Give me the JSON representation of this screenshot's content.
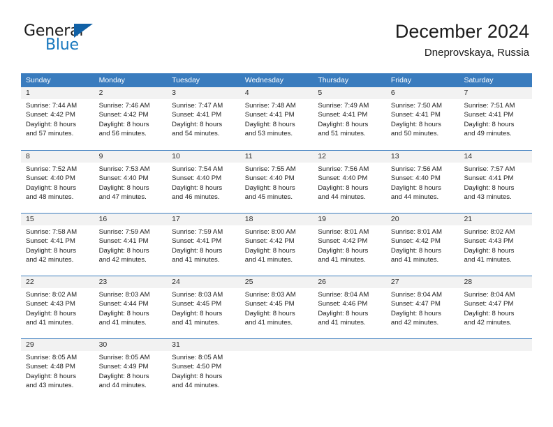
{
  "brand": {
    "name_part1": "General",
    "name_part2": "Blue",
    "colors": {
      "blue": "#1878be",
      "flag": "#1161a6",
      "dark": "#1b1b1b"
    }
  },
  "header": {
    "title": "December 2024",
    "subtitle": "Dneprovskaya, Russia"
  },
  "theme": {
    "header_bar": "#3a7cbe",
    "day_band": "#f2f2f2",
    "row_divider": "#3a7cbe",
    "text": "#202020"
  },
  "weekdays": [
    "Sunday",
    "Monday",
    "Tuesday",
    "Wednesday",
    "Thursday",
    "Friday",
    "Saturday"
  ],
  "weeks": [
    [
      {
        "day": "1",
        "sunrise": "Sunrise: 7:44 AM",
        "sunset": "Sunset: 4:42 PM",
        "daylight1": "Daylight: 8 hours",
        "daylight2": "and 57 minutes."
      },
      {
        "day": "2",
        "sunrise": "Sunrise: 7:46 AM",
        "sunset": "Sunset: 4:42 PM",
        "daylight1": "Daylight: 8 hours",
        "daylight2": "and 56 minutes."
      },
      {
        "day": "3",
        "sunrise": "Sunrise: 7:47 AM",
        "sunset": "Sunset: 4:41 PM",
        "daylight1": "Daylight: 8 hours",
        "daylight2": "and 54 minutes."
      },
      {
        "day": "4",
        "sunrise": "Sunrise: 7:48 AM",
        "sunset": "Sunset: 4:41 PM",
        "daylight1": "Daylight: 8 hours",
        "daylight2": "and 53 minutes."
      },
      {
        "day": "5",
        "sunrise": "Sunrise: 7:49 AM",
        "sunset": "Sunset: 4:41 PM",
        "daylight1": "Daylight: 8 hours",
        "daylight2": "and 51 minutes."
      },
      {
        "day": "6",
        "sunrise": "Sunrise: 7:50 AM",
        "sunset": "Sunset: 4:41 PM",
        "daylight1": "Daylight: 8 hours",
        "daylight2": "and 50 minutes."
      },
      {
        "day": "7",
        "sunrise": "Sunrise: 7:51 AM",
        "sunset": "Sunset: 4:41 PM",
        "daylight1": "Daylight: 8 hours",
        "daylight2": "and 49 minutes."
      }
    ],
    [
      {
        "day": "8",
        "sunrise": "Sunrise: 7:52 AM",
        "sunset": "Sunset: 4:40 PM",
        "daylight1": "Daylight: 8 hours",
        "daylight2": "and 48 minutes."
      },
      {
        "day": "9",
        "sunrise": "Sunrise: 7:53 AM",
        "sunset": "Sunset: 4:40 PM",
        "daylight1": "Daylight: 8 hours",
        "daylight2": "and 47 minutes."
      },
      {
        "day": "10",
        "sunrise": "Sunrise: 7:54 AM",
        "sunset": "Sunset: 4:40 PM",
        "daylight1": "Daylight: 8 hours",
        "daylight2": "and 46 minutes."
      },
      {
        "day": "11",
        "sunrise": "Sunrise: 7:55 AM",
        "sunset": "Sunset: 4:40 PM",
        "daylight1": "Daylight: 8 hours",
        "daylight2": "and 45 minutes."
      },
      {
        "day": "12",
        "sunrise": "Sunrise: 7:56 AM",
        "sunset": "Sunset: 4:40 PM",
        "daylight1": "Daylight: 8 hours",
        "daylight2": "and 44 minutes."
      },
      {
        "day": "13",
        "sunrise": "Sunrise: 7:56 AM",
        "sunset": "Sunset: 4:40 PM",
        "daylight1": "Daylight: 8 hours",
        "daylight2": "and 44 minutes."
      },
      {
        "day": "14",
        "sunrise": "Sunrise: 7:57 AM",
        "sunset": "Sunset: 4:41 PM",
        "daylight1": "Daylight: 8 hours",
        "daylight2": "and 43 minutes."
      }
    ],
    [
      {
        "day": "15",
        "sunrise": "Sunrise: 7:58 AM",
        "sunset": "Sunset: 4:41 PM",
        "daylight1": "Daylight: 8 hours",
        "daylight2": "and 42 minutes."
      },
      {
        "day": "16",
        "sunrise": "Sunrise: 7:59 AM",
        "sunset": "Sunset: 4:41 PM",
        "daylight1": "Daylight: 8 hours",
        "daylight2": "and 42 minutes."
      },
      {
        "day": "17",
        "sunrise": "Sunrise: 7:59 AM",
        "sunset": "Sunset: 4:41 PM",
        "daylight1": "Daylight: 8 hours",
        "daylight2": "and 41 minutes."
      },
      {
        "day": "18",
        "sunrise": "Sunrise: 8:00 AM",
        "sunset": "Sunset: 4:42 PM",
        "daylight1": "Daylight: 8 hours",
        "daylight2": "and 41 minutes."
      },
      {
        "day": "19",
        "sunrise": "Sunrise: 8:01 AM",
        "sunset": "Sunset: 4:42 PM",
        "daylight1": "Daylight: 8 hours",
        "daylight2": "and 41 minutes."
      },
      {
        "day": "20",
        "sunrise": "Sunrise: 8:01 AM",
        "sunset": "Sunset: 4:42 PM",
        "daylight1": "Daylight: 8 hours",
        "daylight2": "and 41 minutes."
      },
      {
        "day": "21",
        "sunrise": "Sunrise: 8:02 AM",
        "sunset": "Sunset: 4:43 PM",
        "daylight1": "Daylight: 8 hours",
        "daylight2": "and 41 minutes."
      }
    ],
    [
      {
        "day": "22",
        "sunrise": "Sunrise: 8:02 AM",
        "sunset": "Sunset: 4:43 PM",
        "daylight1": "Daylight: 8 hours",
        "daylight2": "and 41 minutes."
      },
      {
        "day": "23",
        "sunrise": "Sunrise: 8:03 AM",
        "sunset": "Sunset: 4:44 PM",
        "daylight1": "Daylight: 8 hours",
        "daylight2": "and 41 minutes."
      },
      {
        "day": "24",
        "sunrise": "Sunrise: 8:03 AM",
        "sunset": "Sunset: 4:45 PM",
        "daylight1": "Daylight: 8 hours",
        "daylight2": "and 41 minutes."
      },
      {
        "day": "25",
        "sunrise": "Sunrise: 8:03 AM",
        "sunset": "Sunset: 4:45 PM",
        "daylight1": "Daylight: 8 hours",
        "daylight2": "and 41 minutes."
      },
      {
        "day": "26",
        "sunrise": "Sunrise: 8:04 AM",
        "sunset": "Sunset: 4:46 PM",
        "daylight1": "Daylight: 8 hours",
        "daylight2": "and 41 minutes."
      },
      {
        "day": "27",
        "sunrise": "Sunrise: 8:04 AM",
        "sunset": "Sunset: 4:47 PM",
        "daylight1": "Daylight: 8 hours",
        "daylight2": "and 42 minutes."
      },
      {
        "day": "28",
        "sunrise": "Sunrise: 8:04 AM",
        "sunset": "Sunset: 4:47 PM",
        "daylight1": "Daylight: 8 hours",
        "daylight2": "and 42 minutes."
      }
    ],
    [
      {
        "day": "29",
        "sunrise": "Sunrise: 8:05 AM",
        "sunset": "Sunset: 4:48 PM",
        "daylight1": "Daylight: 8 hours",
        "daylight2": "and 43 minutes."
      },
      {
        "day": "30",
        "sunrise": "Sunrise: 8:05 AM",
        "sunset": "Sunset: 4:49 PM",
        "daylight1": "Daylight: 8 hours",
        "daylight2": "and 44 minutes."
      },
      {
        "day": "31",
        "sunrise": "Sunrise: 8:05 AM",
        "sunset": "Sunset: 4:50 PM",
        "daylight1": "Daylight: 8 hours",
        "daylight2": "and 44 minutes."
      },
      {
        "day": "",
        "sunrise": "",
        "sunset": "",
        "daylight1": "",
        "daylight2": ""
      },
      {
        "day": "",
        "sunrise": "",
        "sunset": "",
        "daylight1": "",
        "daylight2": ""
      },
      {
        "day": "",
        "sunrise": "",
        "sunset": "",
        "daylight1": "",
        "daylight2": ""
      },
      {
        "day": "",
        "sunrise": "",
        "sunset": "",
        "daylight1": "",
        "daylight2": ""
      }
    ]
  ]
}
